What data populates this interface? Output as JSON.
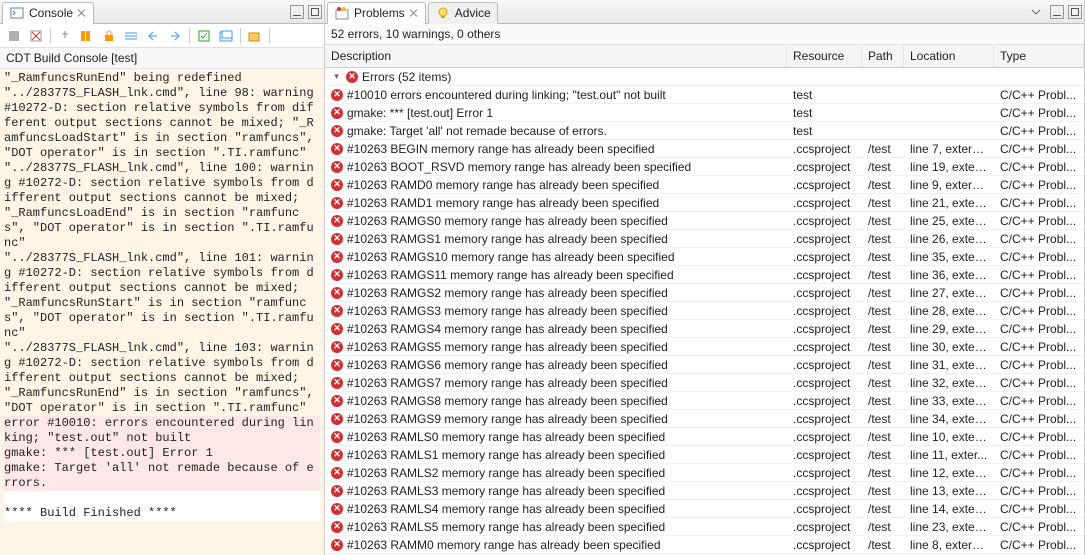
{
  "left": {
    "tab": "Console",
    "title": "CDT Build Console [test]",
    "body_warn": "\"_RamfuncsRunEnd\" being redefined\n\"../28377S_FLASH_lnk.cmd\", line 98: warning #10272-D: section relative symbols from different output sections cannot be mixed; \"_RamfuncsLoadStart\" is in section \"ramfuncs\", \"DOT operator\" is in section \".TI.ramfunc\"\n\"../28377S_FLASH_lnk.cmd\", line 100: warning #10272-D: section relative symbols from different output sections cannot be mixed; \"_RamfuncsLoadEnd\" is in section \"ramfuncs\", \"DOT operator\" is in section \".TI.ramfunc\"\n\"../28377S_FLASH_lnk.cmd\", line 101: warning #10272-D: section relative symbols from different output sections cannot be mixed; \"_RamfuncsRunStart\" is in section \"ramfuncs\", \"DOT operator\" is in section \".TI.ramfunc\"\n\"../28377S_FLASH_lnk.cmd\", line 103: warning #10272-D: section relative symbols from different output sections cannot be mixed; \"_RamfuncsRunEnd\" is in section \"ramfuncs\", \"DOT operator\" is in section \".TI.ramfunc\"",
    "body_err": "error #10010: errors encountered during linking; \"test.out\" not built\ngmake: *** [test.out] Error 1\ngmake: Target 'all' not remade because of errors.",
    "body_fin": "\n**** Build Finished ****\n"
  },
  "right": {
    "tab1": "Problems",
    "tab2": "Advice",
    "summary": "52 errors, 10 warnings, 0 others",
    "cols": {
      "desc": "Description",
      "res": "Resource",
      "path": "Path",
      "loc": "Location",
      "type": "Type"
    },
    "group": "Errors (52 items)",
    "rows": [
      {
        "d": "#10010 errors encountered during linking; \"test.out\" not built",
        "r": "test",
        "p": "",
        "l": "",
        "t": "C/C++ Probl..."
      },
      {
        "d": "gmake: *** [test.out] Error 1",
        "r": "test",
        "p": "",
        "l": "",
        "t": "C/C++ Probl..."
      },
      {
        "d": "gmake: Target 'all' not remade because of errors.",
        "r": "test",
        "p": "",
        "l": "",
        "t": "C/C++ Probl..."
      },
      {
        "d": "#10263 BEGIN memory range has already been specified",
        "r": ".ccsproject",
        "p": "/test",
        "l": "line 7, extern...",
        "t": "C/C++ Probl..."
      },
      {
        "d": "#10263 BOOT_RSVD memory range has already been specified",
        "r": ".ccsproject",
        "p": "/test",
        "l": "line 19, exter...",
        "t": "C/C++ Probl..."
      },
      {
        "d": "#10263 RAMD0 memory range has already been specified",
        "r": ".ccsproject",
        "p": "/test",
        "l": "line 9, extern...",
        "t": "C/C++ Probl..."
      },
      {
        "d": "#10263 RAMD1 memory range has already been specified",
        "r": ".ccsproject",
        "p": "/test",
        "l": "line 21, exter...",
        "t": "C/C++ Probl..."
      },
      {
        "d": "#10263 RAMGS0 memory range has already been specified",
        "r": ".ccsproject",
        "p": "/test",
        "l": "line 25, exter...",
        "t": "C/C++ Probl..."
      },
      {
        "d": "#10263 RAMGS1 memory range has already been specified",
        "r": ".ccsproject",
        "p": "/test",
        "l": "line 26, exter...",
        "t": "C/C++ Probl..."
      },
      {
        "d": "#10263 RAMGS10 memory range has already been specified",
        "r": ".ccsproject",
        "p": "/test",
        "l": "line 35, exter...",
        "t": "C/C++ Probl..."
      },
      {
        "d": "#10263 RAMGS11 memory range has already been specified",
        "r": ".ccsproject",
        "p": "/test",
        "l": "line 36, exter...",
        "t": "C/C++ Probl..."
      },
      {
        "d": "#10263 RAMGS2 memory range has already been specified",
        "r": ".ccsproject",
        "p": "/test",
        "l": "line 27, exter...",
        "t": "C/C++ Probl..."
      },
      {
        "d": "#10263 RAMGS3 memory range has already been specified",
        "r": ".ccsproject",
        "p": "/test",
        "l": "line 28, exter...",
        "t": "C/C++ Probl..."
      },
      {
        "d": "#10263 RAMGS4 memory range has already been specified",
        "r": ".ccsproject",
        "p": "/test",
        "l": "line 29, exter...",
        "t": "C/C++ Probl..."
      },
      {
        "d": "#10263 RAMGS5 memory range has already been specified",
        "r": ".ccsproject",
        "p": "/test",
        "l": "line 30, exter...",
        "t": "C/C++ Probl..."
      },
      {
        "d": "#10263 RAMGS6 memory range has already been specified",
        "r": ".ccsproject",
        "p": "/test",
        "l": "line 31, exter...",
        "t": "C/C++ Probl..."
      },
      {
        "d": "#10263 RAMGS7 memory range has already been specified",
        "r": ".ccsproject",
        "p": "/test",
        "l": "line 32, exter...",
        "t": "C/C++ Probl..."
      },
      {
        "d": "#10263 RAMGS8 memory range has already been specified",
        "r": ".ccsproject",
        "p": "/test",
        "l": "line 33, exter...",
        "t": "C/C++ Probl..."
      },
      {
        "d": "#10263 RAMGS9 memory range has already been specified",
        "r": ".ccsproject",
        "p": "/test",
        "l": "line 34, exter...",
        "t": "C/C++ Probl..."
      },
      {
        "d": "#10263 RAMLS0 memory range has already been specified",
        "r": ".ccsproject",
        "p": "/test",
        "l": "line 10, exter...",
        "t": "C/C++ Probl..."
      },
      {
        "d": "#10263 RAMLS1 memory range has already been specified",
        "r": ".ccsproject",
        "p": "/test",
        "l": "line 11, exter...",
        "t": "C/C++ Probl..."
      },
      {
        "d": "#10263 RAMLS2 memory range has already been specified",
        "r": ".ccsproject",
        "p": "/test",
        "l": "line 12, exter...",
        "t": "C/C++ Probl..."
      },
      {
        "d": "#10263 RAMLS3 memory range has already been specified",
        "r": ".ccsproject",
        "p": "/test",
        "l": "line 13, exter...",
        "t": "C/C++ Probl..."
      },
      {
        "d": "#10263 RAMLS4 memory range has already been specified",
        "r": ".ccsproject",
        "p": "/test",
        "l": "line 14, exter...",
        "t": "C/C++ Probl..."
      },
      {
        "d": "#10263 RAMLS5 memory range has already been specified",
        "r": ".ccsproject",
        "p": "/test",
        "l": "line 23, exter...",
        "t": "C/C++ Probl..."
      },
      {
        "d": "#10263 RAMM0 memory range has already been specified",
        "r": ".ccsproject",
        "p": "/test",
        "l": "line 8, extern...",
        "t": "C/C++ Probl..."
      }
    ]
  }
}
